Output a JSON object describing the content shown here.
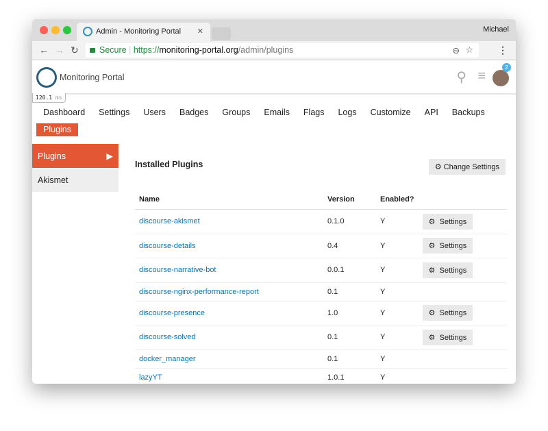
{
  "browser": {
    "tab_title": "Admin - Monitoring Portal",
    "user": "Michael",
    "secure_label": "Secure",
    "url_scheme": "https://",
    "url_host": "monitoring-portal.org",
    "url_path": "/admin/plugins"
  },
  "header": {
    "site_name": "Monitoring Portal",
    "timer_value": "120.1",
    "timer_unit": "ms",
    "notification_count": "2"
  },
  "nav": [
    "Dashboard",
    "Settings",
    "Users",
    "Badges",
    "Groups",
    "Emails",
    "Flags",
    "Logs",
    "Customize",
    "API",
    "Backups",
    "Plugins"
  ],
  "sidebar": [
    "Plugins",
    "Akismet"
  ],
  "main": {
    "title": "Installed Plugins",
    "change_settings": "Change Settings",
    "columns": [
      "Name",
      "Version",
      "Enabled?"
    ],
    "settings_label": "Settings",
    "plugins": [
      {
        "name": "discourse-akismet",
        "version": "0.1.0",
        "enabled": "Y",
        "settings": true
      },
      {
        "name": "discourse-details",
        "version": "0.4",
        "enabled": "Y",
        "settings": true
      },
      {
        "name": "discourse-narrative-bot",
        "version": "0.0.1",
        "enabled": "Y",
        "settings": true
      },
      {
        "name": "discourse-nginx-performance-report",
        "version": "0.1",
        "enabled": "Y",
        "settings": false
      },
      {
        "name": "discourse-presence",
        "version": "1.0",
        "enabled": "Y",
        "settings": true
      },
      {
        "name": "discourse-solved",
        "version": "0.1",
        "enabled": "Y",
        "settings": true
      },
      {
        "name": "docker_manager",
        "version": "0.1",
        "enabled": "Y",
        "settings": false
      },
      {
        "name": "lazyYT",
        "version": "1.0.1",
        "enabled": "Y",
        "settings": false
      }
    ]
  },
  "colors": {
    "accent": "#e45735",
    "link": "#0a73b8",
    "secure": "#1e8e3e"
  }
}
